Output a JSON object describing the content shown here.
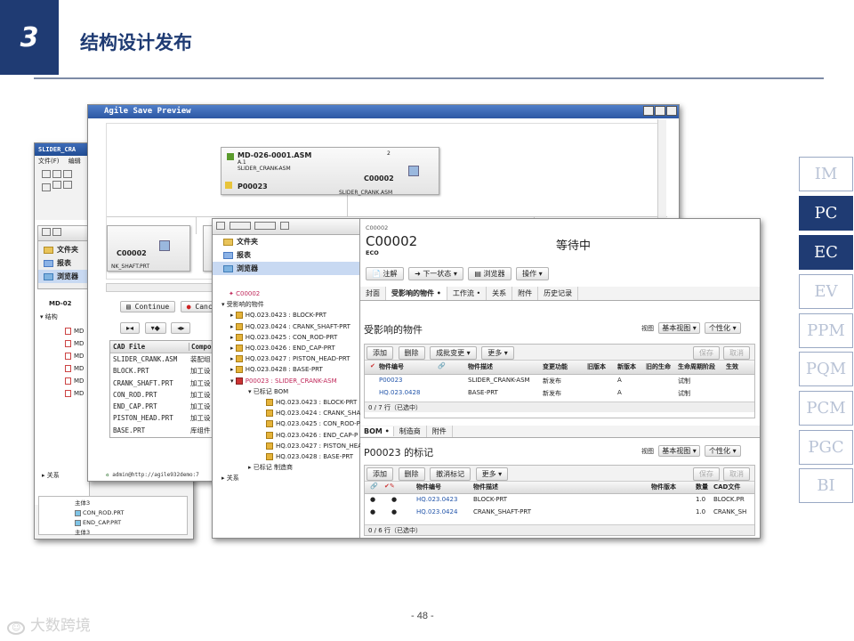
{
  "slide": {
    "number": "3",
    "title": "结构设计发布",
    "page_label": "- 48 -",
    "watermark": "大数跨境"
  },
  "nav": [
    "IM",
    "PC",
    "EC",
    "EV",
    "PPM",
    "PQM",
    "PCM",
    "PGC",
    "BI"
  ],
  "back_window": {
    "title": "SLIDER_CRA",
    "menu": [
      "文件(F)",
      "编辑"
    ],
    "tree_root": "MD-02",
    "tree_group": "结构",
    "tree_items": [
      "MD",
      "MD",
      "MD",
      "MD",
      "MD",
      "MD"
    ],
    "relation": "关系",
    "bottom_items": [
      "主体3",
      "CON_ROD.PRT",
      "END_CAP.PRT",
      "主体3"
    ]
  },
  "nav_panel": {
    "items": [
      "文件夹",
      "报表",
      "浏览器"
    ]
  },
  "preview": {
    "title": "Agile Save Preview",
    "top_node": {
      "name": "MD-026-0001.ASM",
      "rev": "A.1",
      "sub": "SLIDER_CRANK-ASM",
      "num": "2",
      "item": "P00023",
      "eco": "C00002",
      "foot": "SLIDER_CRANK.ASM"
    },
    "left_node": {
      "eco": "C00002",
      "foot": "NK_SHAFT.PRT"
    },
    "continue_btn": "Continue",
    "cancel_btn": "Cancel",
    "col_file": "CAD File",
    "col_comp": "Compo",
    "files": [
      [
        "SLIDER_CRANK.ASM",
        "装配组"
      ],
      [
        "BLOCK.PRT",
        "加工设"
      ],
      [
        "CRANK_SHAFT.PRT",
        "加工设"
      ],
      [
        "CON_ROD.PRT",
        "加工设"
      ],
      [
        "END_CAP.PRT",
        "加工设"
      ],
      [
        "PISTON_HEAD.PRT",
        "加工设"
      ],
      [
        "BASE.PRT",
        "库组件"
      ]
    ],
    "status": "admin@http://agile932demo:7"
  },
  "explorer": {
    "folder": "文件夹",
    "report": "报表",
    "browser": "浏览器",
    "eco": "C00002",
    "affected": "受影响的物件",
    "items": [
      "HQ.023.0423 : BLOCK-PRT",
      "HQ.023.0424 : CRANK_SHAFT-PRT",
      "HQ.023.0425 : CON_ROD-PRT",
      "HQ.023.0426 : END_CAP-PRT",
      "HQ.023.0427 : PISTON_HEAD-PRT",
      "HQ.023.0428 : BASE-PRT"
    ],
    "part": "P00023 : SLIDER_CRANK-ASM",
    "bom_label": "已标记 BOM",
    "bom_items": [
      "HQ.023.0423 : BLOCK-PRT",
      "HQ.023.0424 : CRANK_SHA",
      "HQ.023.0425 : CON_ROD-P",
      "HQ.023.0426 : END_CAP-P",
      "HQ.023.0427 : PISTON_HEA",
      "HQ.023.0428 : BASE-PRT"
    ],
    "mfr": "已标记 制造商",
    "relation": "关系"
  },
  "eco_panel": {
    "small_id": "C00002",
    "id": "C00002",
    "type": "ECO",
    "status": "等待中",
    "buttons": [
      "注解",
      "下一状态",
      "浏览器",
      "操作"
    ],
    "tabs": [
      "封面",
      "受影响的物件",
      "工作流",
      "关系",
      "附件",
      "历史记录"
    ],
    "section1": "受影响的物件",
    "view_label": "视图",
    "view_value": "基本视图",
    "personalize": "个性化",
    "grid1_buttons": [
      "添加",
      "删除",
      "成批变更",
      "更多"
    ],
    "save": "保存",
    "cancel": "取消",
    "grid1_headers": [
      "物件编号",
      "物件描述",
      "变更功能",
      "旧版本",
      "新版本",
      "旧的生命",
      "生命周期阶段",
      "生效"
    ],
    "grid1_rows": [
      [
        "P00023",
        "SLIDER_CRANK-ASM",
        "新发布",
        "A",
        "试制"
      ],
      [
        "HQ.023.0428",
        "BASE-PRT",
        "新发布",
        "A",
        "试制"
      ]
    ],
    "grid1_count": "0 / 7 行（已选中）",
    "sub_tabs": [
      "BOM",
      "制造商",
      "附件"
    ],
    "section2": "P00023 的标记",
    "grid2_buttons": [
      "添加",
      "删除",
      "撤消标记",
      "更多"
    ],
    "grid2_headers": [
      "物件编号",
      "物件描述",
      "物件版本",
      "数量",
      "CAD文件"
    ],
    "grid2_rows": [
      [
        "HQ.023.0423",
        "BLOCK-PRT",
        "1.0",
        "BLOCK.PR"
      ],
      [
        "HQ.023.0424",
        "CRANK_SHAFT-PRT",
        "1.0",
        "CRANK_SH"
      ]
    ],
    "grid2_count": "0 / 6 行（已选中）"
  }
}
